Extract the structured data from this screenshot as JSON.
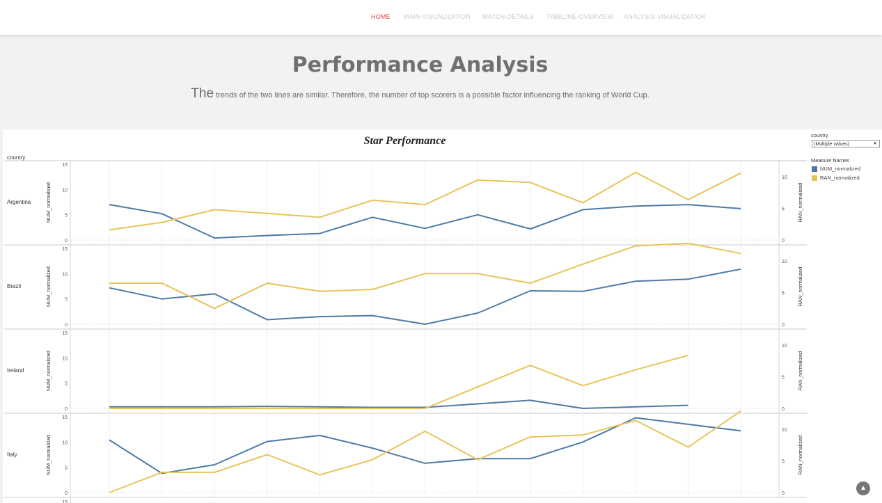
{
  "nav": {
    "items": [
      "HOME",
      "MAIN-VISUALIZATION",
      "MATCH-DETAILS",
      "TIMELINE-OVERVIEW",
      "ANALYSIS-VISUALIZATION"
    ]
  },
  "hero": {
    "title": "Performance Analysis",
    "subtitle_lead": "The",
    "subtitle_rest": " trends of the two lines are similar. Therefore, the number of top scorers is a possible factor influencing the ranking of World Cup."
  },
  "filter": {
    "label": "country",
    "value": "(Multiple values)"
  },
  "legend": {
    "title": "Measure Names",
    "items": [
      {
        "name": "NUM_normalized",
        "color": "#4e79a7"
      },
      {
        "name": "RAN_normalized",
        "color": "#e8c35a"
      }
    ]
  },
  "icons": {
    "scroll_top": "chevron-up-icon"
  },
  "chart_data": {
    "type": "line",
    "title": "Star Performance",
    "row_header": "country",
    "left_axis_label": "NUM_normalized",
    "right_axis_label": "RAN_normalized",
    "left_ylim": [
      0,
      15
    ],
    "right_ylim": [
      0,
      12
    ],
    "left_ticks": [
      0,
      5,
      10,
      15
    ],
    "right_ticks": [
      0,
      5,
      10
    ],
    "grid": "vertical",
    "colors": {
      "NUM_normalized": "#4e79a7",
      "RAN_normalized": "#e8c35a"
    },
    "panels": [
      {
        "country": "Argentina",
        "NUM_normalized": [
          7,
          5.2,
          0.4,
          0.9,
          1.3,
          4.5,
          2.3,
          5,
          2.2,
          6,
          6.7,
          7,
          6.2
        ],
        "RAN_normalized": [
          1.6,
          2.8,
          4.8,
          4.2,
          3.6,
          6.3,
          5.6,
          9.5,
          9.1,
          5.9,
          10.7,
          6.4,
          10.6
        ]
      },
      {
        "country": "Brazil",
        "NUM_normalized": [
          7.2,
          5,
          6,
          0.9,
          1.5,
          1.7,
          0,
          2.2,
          6.6,
          6.5,
          8.5,
          8.9,
          10.9
        ],
        "RAN_normalized": [
          6.5,
          6.5,
          2.5,
          6.5,
          5.2,
          5.5,
          8,
          8,
          6.5,
          9.5,
          12.4,
          12.8,
          11.2
        ]
      },
      {
        "country": "Ireland",
        "NUM_normalized": [
          0.3,
          0.3,
          0.3,
          0.4,
          0.3,
          0.2,
          0.2,
          0.9,
          1.6,
          0,
          0.3,
          0.6,
          null
        ],
        "RAN_normalized": [
          0,
          0,
          0,
          0,
          0,
          0,
          0,
          3.4,
          6.8,
          3.6,
          6.1,
          8.4,
          null
        ]
      },
      {
        "country": "Italy",
        "NUM_normalized": [
          10.4,
          3.8,
          5.5,
          10.1,
          11.3,
          8.8,
          5.8,
          6.7,
          6.7,
          10,
          14.8,
          13.5,
          12.2
        ],
        "RAN_normalized": [
          0,
          3.2,
          3.2,
          6,
          2.8,
          5.2,
          9.7,
          5.2,
          8.8,
          9.1,
          11.4,
          7.2,
          12.9
        ]
      }
    ]
  }
}
